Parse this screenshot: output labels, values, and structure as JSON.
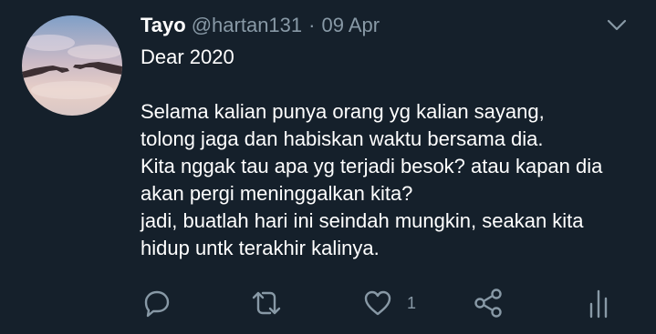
{
  "tweet": {
    "name": "Tayo",
    "handle": "@hartan131",
    "separator": "·",
    "date": "09 Apr",
    "lines": [
      "Dear 2020",
      "",
      "Selama kalian punya orang yg kalian sayang,",
      "tolong jaga dan habiskan waktu bersama dia.",
      "Kita nggak tau apa yg terjadi besok? atau kapan dia",
      "akan pergi meninggalkan kita?",
      "jadi, buatlah hari ini seindah mungkin, seakan kita",
      "hidup untk terakhir kalinya."
    ]
  },
  "actions": {
    "reply_icon": "reply-icon",
    "retweet_icon": "retweet-icon",
    "like_icon": "heart-icon",
    "like_count": "1",
    "share_icon": "share-icon",
    "analytics_icon": "analytics-icon"
  },
  "colors": {
    "background": "#15202b",
    "text": "#ffffff",
    "muted": "#8899a6"
  }
}
